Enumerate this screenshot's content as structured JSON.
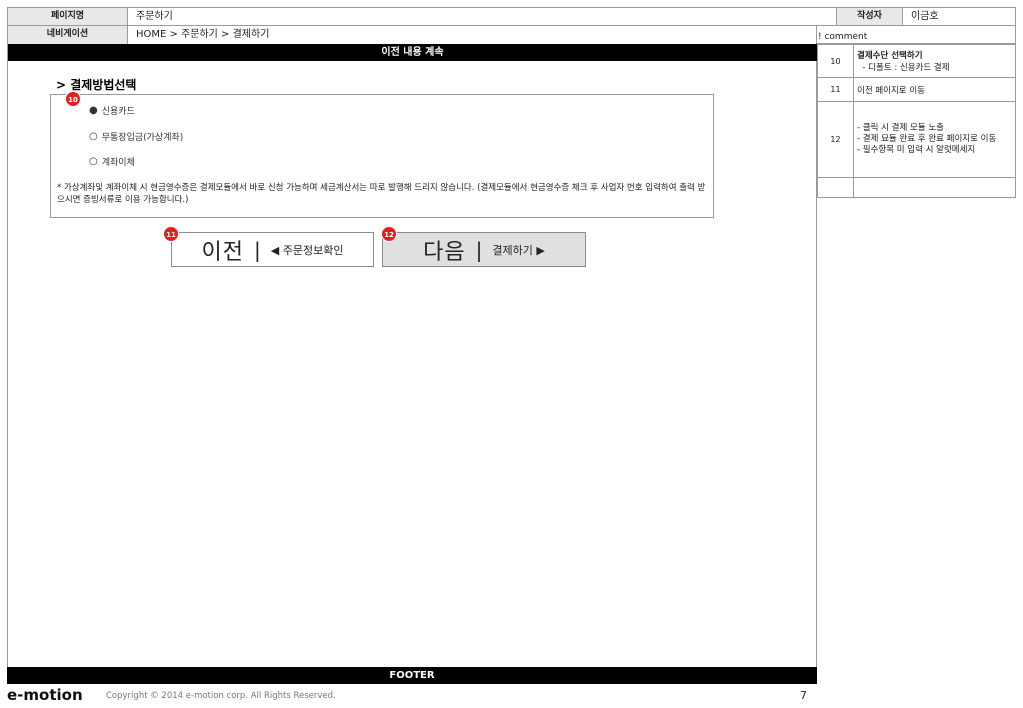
{
  "header": {
    "page_name_label": "페이지명",
    "page_name_value": "주문하기",
    "author_label": "작성자",
    "author_value": "이금호",
    "nav_label": "네비게이션",
    "nav_value": "HOME > 주문하기 > 결제하기",
    "comment_label": "! comment"
  },
  "main": {
    "top_banner": "이전 내용 계속",
    "section_title": "> 결제방법선택",
    "options": [
      {
        "radio": "●",
        "label": "신용카드",
        "selected": true
      },
      {
        "radio": "○",
        "label": "무통장입금(가상계좌)",
        "selected": false
      },
      {
        "radio": "○",
        "label": "계좌이체",
        "selected": false
      }
    ],
    "note": "* 가상계좌및 계좌이체 시 현금영수증은 결제모듈에서 바로 신청 가능하며 세금계산서는 따로 발행해 드리지 않습니다. (결제모듈에서 현금영수증 체크 후 사업자 번호 입력하여 출력 받으시면 증빙서류로 이용 가능합니다.)",
    "prev_button": {
      "big": "이전",
      "sep": "|",
      "small": "◀ 주문정보확인"
    },
    "next_button": {
      "big": "다음",
      "sep": "|",
      "small": "결제하기 ▶"
    }
  },
  "badges": {
    "b10": "10",
    "b11": "11",
    "b12": "12"
  },
  "comments": [
    {
      "num": "10",
      "title": "결제수단 선택하기",
      "lines": [
        "  - 디폴트 : 신용카드 결제"
      ]
    },
    {
      "num": "11",
      "title": "",
      "lines": [
        "이전 페이지로 이동"
      ]
    },
    {
      "num": "12",
      "title": "",
      "lines": [
        "- 클릭 시 결제 모듈 노출",
        "- 결제 묘듈 완료 후 완료 페이지로 이동",
        "- 필수항목 미 입력 시 알럿메세지"
      ]
    },
    {
      "num": "",
      "title": "",
      "lines": [
        ""
      ]
    }
  ],
  "footer": {
    "bar": "FOOTER",
    "brand": "e-motion",
    "copyright": "Copyright © 2014 e-motion corp. All Rights Reserved.",
    "page_number": "7"
  },
  "colors": {
    "badge": "#e0221c",
    "bar": "#000000",
    "next_button_bg": "#e0e0e0"
  }
}
